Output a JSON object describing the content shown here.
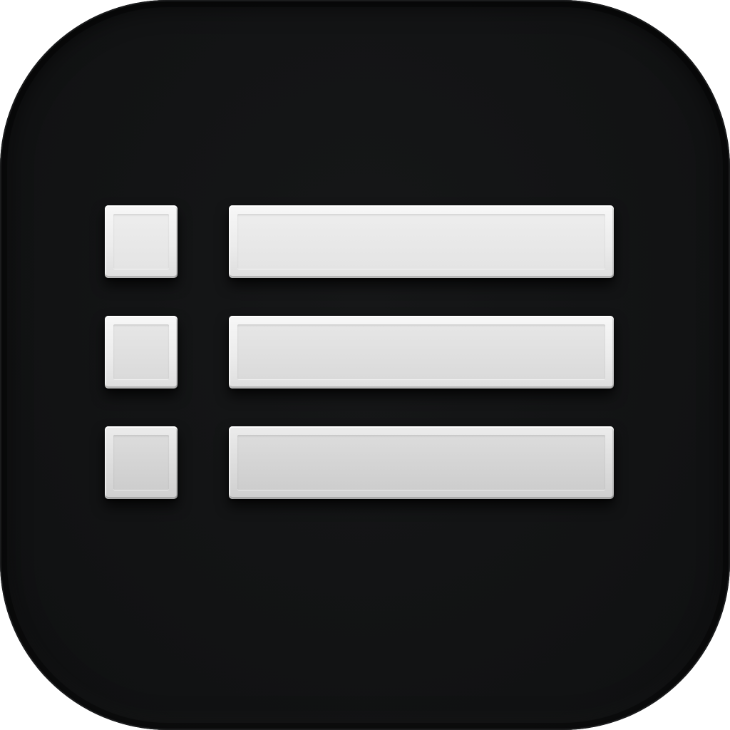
{
  "icon": {
    "name": "list-icon",
    "background_color": "#131415",
    "bar_color": "#ececec",
    "rows": [
      {
        "bullet": "bullet",
        "line": "line"
      },
      {
        "bullet": "bullet",
        "line": "line"
      },
      {
        "bullet": "bullet",
        "line": "line"
      }
    ]
  }
}
